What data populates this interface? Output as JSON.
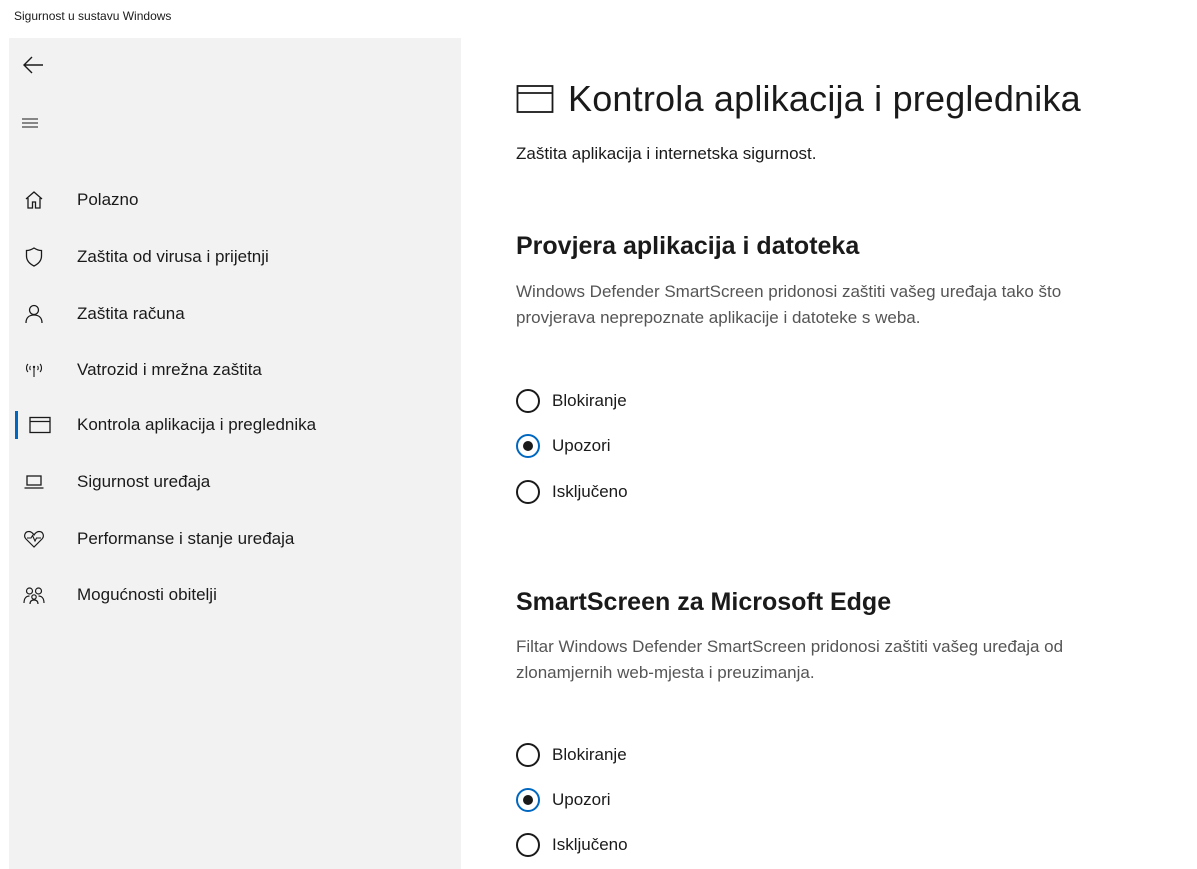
{
  "window": {
    "title": "Sigurnost u sustavu Windows"
  },
  "sidebar": {
    "back_icon": "back-arrow-icon",
    "menu_icon": "hamburger-icon",
    "items": [
      {
        "label": "Polazno",
        "icon": "home-icon"
      },
      {
        "label": "Zaštita od virusa i prijetnji",
        "icon": "shield-icon"
      },
      {
        "label": "Zaštita računa",
        "icon": "person-icon"
      },
      {
        "label": "Vatrozid i mrežna zaštita",
        "icon": "wireless-icon"
      },
      {
        "label": "Kontrola aplikacija i preglednika",
        "icon": "app-window-icon",
        "selected": true
      },
      {
        "label": "Sigurnost uređaja",
        "icon": "laptop-icon"
      },
      {
        "label": "Performanse i stanje uređaja",
        "icon": "heart-pulse-icon"
      },
      {
        "label": "Mogućnosti obitelji",
        "icon": "family-icon"
      }
    ]
  },
  "main": {
    "title": "Kontrola aplikacija i preglednika",
    "subtitle": "Zaštita aplikacija i internetska sigurnost.",
    "sections": [
      {
        "title": "Provjera aplikacija i datoteka",
        "description": [
          "Windows Defender SmartScreen pridonosi zaštiti vašeg uređaja tako što",
          "provjerava neprepoznate aplikacije i datoteke s weba."
        ],
        "options": [
          "Blokiranje",
          "Upozori",
          "Isključeno"
        ],
        "selected": "Upozori"
      },
      {
        "title": "SmartScreen za Microsoft Edge",
        "description": [
          "Filtar Windows Defender SmartScreen pridonosi zaštiti vašeg uređaja od",
          "zlonamjernih web-mjesta i preuzimanja."
        ],
        "options": [
          "Blokiranje",
          "Upozori",
          "Isključeno"
        ],
        "selected": "Upozori"
      }
    ]
  },
  "colors": {
    "accent": "#0067c0",
    "sidebar_bg": "#f2f2f2",
    "text": "#1a1a1a",
    "secondary_text": "#555555"
  }
}
